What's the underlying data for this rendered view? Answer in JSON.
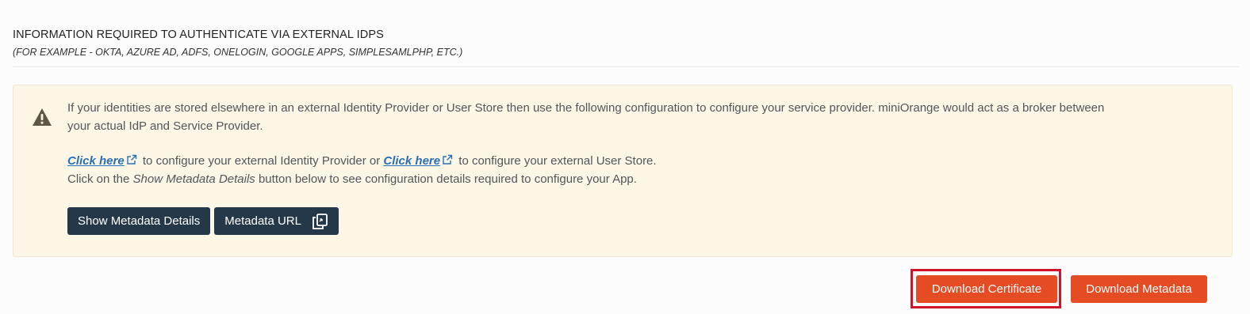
{
  "section": {
    "title": "INFORMATION REQUIRED TO AUTHENTICATE VIA EXTERNAL IDPS",
    "subtitle": "(FOR EXAMPLE - OKTA, AZURE AD, ADFS, ONELOGIN, GOOGLE APPS, SIMPLESAMLPHP, ETC.)"
  },
  "info": {
    "paragraph": "If your identities are stored elsewhere in an external Identity Provider or User Store then use the following configuration to configure your service provider. miniOrange would act as a broker between your actual IdP and Service Provider.",
    "link1": "Click here",
    "text1": "to configure your external Identity Provider or",
    "link2": "Click here",
    "text2": "to configure your external User Store.",
    "line2_prefix": "Click on the",
    "line2_em": "Show Metadata Details",
    "line2_suffix": "button below to see configuration details required to configure your App.",
    "warning_icon": "warning-triangle-icon",
    "external_icon": "external-link-icon"
  },
  "buttons": {
    "show_metadata": "Show Metadata Details",
    "metadata_url": "Metadata URL",
    "copy_icon": "copy-icon",
    "download_certificate": "Download Certificate",
    "download_metadata": "Download Metadata"
  },
  "colors": {
    "info_bg": "#fcf6e6",
    "dark_button": "#25384a",
    "orange_button": "#e64c23",
    "link": "#2a6fb5",
    "highlight": "#d1132a"
  }
}
